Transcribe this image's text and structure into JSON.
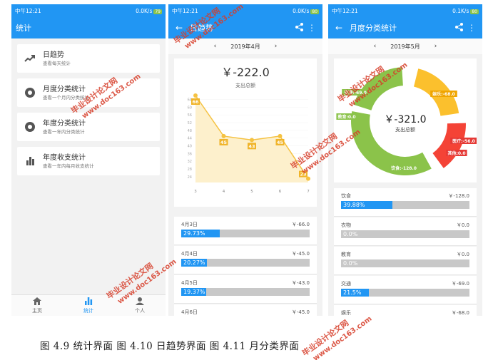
{
  "status": {
    "p1": {
      "time": "中午12:21",
      "net": "0.0K/s",
      "batt": "79"
    },
    "p2": {
      "time": "中午12:21",
      "net": "0.0K/s",
      "batt": "80"
    },
    "p3": {
      "time": "中午12:21",
      "net": "0.1K/s",
      "batt": "80"
    }
  },
  "screen1": {
    "title": "统计",
    "menu": [
      {
        "title": "日趋势",
        "subtitle": "查看每天统计",
        "icon": "trending-up-icon"
      },
      {
        "title": "月度分类统计",
        "subtitle": "查看一个月内分类统计",
        "icon": "donut-chart-icon"
      },
      {
        "title": "年度分类统计",
        "subtitle": "查看一年内分类统计",
        "icon": "donut-chart-icon"
      },
      {
        "title": "年度收支统计",
        "subtitle": "查看一年内每月收支统计",
        "icon": "bar-chart-icon"
      }
    ],
    "nav": [
      {
        "label": "主页",
        "icon": "home-icon"
      },
      {
        "label": "统计",
        "icon": "bar-chart-icon"
      },
      {
        "label": "个人",
        "icon": "person-icon"
      }
    ]
  },
  "screen2": {
    "title": "日趋势",
    "month": "2019年4月",
    "total": "￥-222.0",
    "total_label": "支出总额",
    "list": [
      {
        "date": "4月3日",
        "amount": "￥-66.0",
        "percent": "29.73%",
        "fraction": 0.2973
      },
      {
        "date": "4月4日",
        "amount": "￥-45.0",
        "percent": "20.27%",
        "fraction": 0.2027
      },
      {
        "date": "4月5日",
        "amount": "￥-43.0",
        "percent": "19.37%",
        "fraction": 0.1937
      },
      {
        "date": "4月6日",
        "amount": "￥-45.0",
        "percent": "",
        "fraction": 0
      }
    ]
  },
  "screen3": {
    "title": "月度分类统计",
    "month": "2019年5月",
    "total": "￥-321.0",
    "total_label": "支出总额",
    "list": [
      {
        "name": "饮食",
        "amount": "￥-128.0",
        "percent": "39.88%",
        "fraction": 0.3988
      },
      {
        "name": "衣物",
        "amount": "￥0.0",
        "percent": "0.0%",
        "fraction": 0
      },
      {
        "name": "教育",
        "amount": "￥0.0",
        "percent": "0.0%",
        "fraction": 0
      },
      {
        "name": "交通",
        "amount": "￥-69.0",
        "percent": "21.5%",
        "fraction": 0.215
      },
      {
        "name": "娱乐",
        "amount": "￥-68.0",
        "percent": "",
        "fraction": 0
      }
    ]
  },
  "chart_data": [
    {
      "type": "area",
      "x": [
        3,
        4,
        5,
        6,
        7
      ],
      "values": [
        66,
        45,
        43,
        45,
        23
      ],
      "ytick_labels": [
        "24",
        "28",
        "32",
        "36",
        "40",
        "44",
        "48",
        "52",
        "56",
        "60",
        "64"
      ],
      "ylim": [
        21,
        66
      ],
      "color": "#f5c242",
      "fill": "#fdf0cc"
    },
    {
      "type": "pie",
      "labels": [
        "饮食",
        "教育",
        "交通",
        "娱乐",
        "医疗",
        "其他"
      ],
      "slice_labels": [
        "饮食:-128.0",
        "教育:0.0",
        "交通:-69.0",
        "娱乐:-68.0",
        "医疗:-56.0",
        "其他:0.0"
      ],
      "values": [
        128,
        0,
        69,
        68,
        56,
        0
      ],
      "colors": [
        "#8bc34a",
        "#8bc34a",
        "#8bc34a",
        "#fbc02d",
        "#f44336",
        "#f44336"
      ],
      "center_text": "￥-321.0",
      "center_subtext": "支出总额"
    }
  ],
  "watermark": {
    "cn": "毕业设计论文网",
    "url": "www.doc163.com"
  },
  "caption": "图 4.9 统计界面 图 4.10 日趋势界面 图 4.11 月分类界面",
  "colors": {
    "primary": "#2196f3",
    "track": "#c8c8c8"
  }
}
